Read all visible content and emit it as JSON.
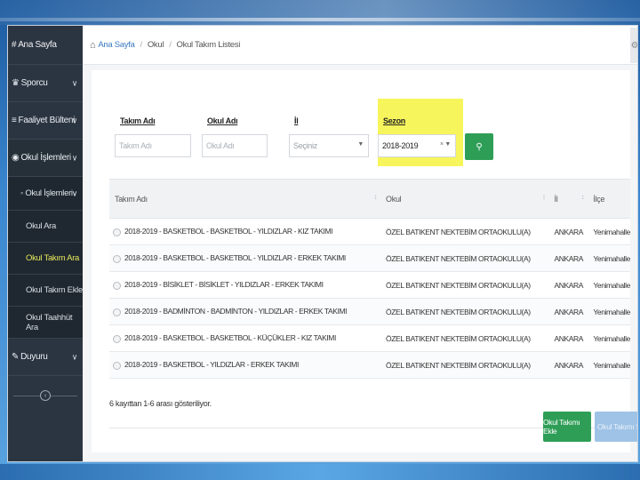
{
  "sidebar": {
    "brand": "# Ana Sayfa",
    "items": [
      {
        "icon": "trophy-icon",
        "label": "Sporcu"
      },
      {
        "icon": "list-icon",
        "label": "Faaliyet Bülteni"
      },
      {
        "icon": "globe-icon",
        "label": "Okul İşlemleri"
      },
      {
        "icon": "edit-icon",
        "label": "Duyuru"
      }
    ],
    "submenu_head": "◦ Okul İşlemleri",
    "links": [
      "Okul Ara",
      "Okul Takım Ara",
      "Okul Takım Ekle",
      "Okul Taahhüt Ara"
    ],
    "active_link_color": "#e8e85a"
  },
  "breadcrumb": {
    "home": "Ana Sayfa",
    "level1": "Okul",
    "level2": "Okul Takım Listesi"
  },
  "filters": {
    "takim_adi": {
      "label": "Takım Adı",
      "placeholder": "Takım Adı"
    },
    "okul_adi": {
      "label": "Okul Adı",
      "placeholder": "Okul Adı"
    },
    "il": {
      "label": "İl",
      "value": "Seçiniz"
    },
    "sezon": {
      "label": "Sezon",
      "value": "2018-2019"
    },
    "highlight_color": "#f7f55c"
  },
  "table": {
    "headers": [
      "Takım Adı",
      "Okul",
      "İl",
      "İlçe"
    ],
    "rows": [
      [
        "2018-2019 - BASKETBOL - BASKETBOL - YILDIZLAR - KIZ TAKIMI",
        "ÖZEL BATIKENT NEKTEBİM ORTAOKULU(A)",
        "ANKARA",
        "Yenimahalle"
      ],
      [
        "2018-2019 - BASKETBOL - BASKETBOL - YILDIZLAR - ERKEK TAKIMI",
        "ÖZEL BATIKENT NEKTEBİM ORTAOKULU(A)",
        "ANKARA",
        "Yenimahalle"
      ],
      [
        "2018-2019 - BİSİKLET - BİSİKLET - YILDIZLAR - ERKEK TAKIMI",
        "ÖZEL BATIKENT NEKTEBİM ORTAOKULU(A)",
        "ANKARA",
        "Yenimahalle"
      ],
      [
        "2018-2019 - BADMİNTON - BADMİNTON - YILDIZLAR - ERKEK TAKIMI",
        "ÖZEL BATIKENT NEKTEBİM ORTAOKULU(A)",
        "ANKARA",
        "Yenimahalle"
      ],
      [
        "2018-2019 - BASKETBOL - BASKETBOL - KÜÇÜKLER - KIZ TAKIMI",
        "ÖZEL BATIKENT NEKTEBİM ORTAOKULU(A)",
        "ANKARA",
        "Yenimahalle"
      ],
      [
        "2018-2019 - BASKETBOL - YILDIZLAR - ERKEK TAKIMI",
        "ÖZEL BATIKENT NEKTEBİM ORTAOKULU(A)",
        "ANKARA",
        "Yenimahalle"
      ]
    ],
    "summary": "6 kayıttan 1-6 arası gösteriliyor."
  },
  "actions": {
    "add": "Okul Takımı Ekle",
    "disabled": "Okul Takımı Sil"
  },
  "colors": {
    "sidebar_bg": "#2b3542",
    "primary_green": "#2e9e57",
    "link_blue": "#3a79c1"
  }
}
